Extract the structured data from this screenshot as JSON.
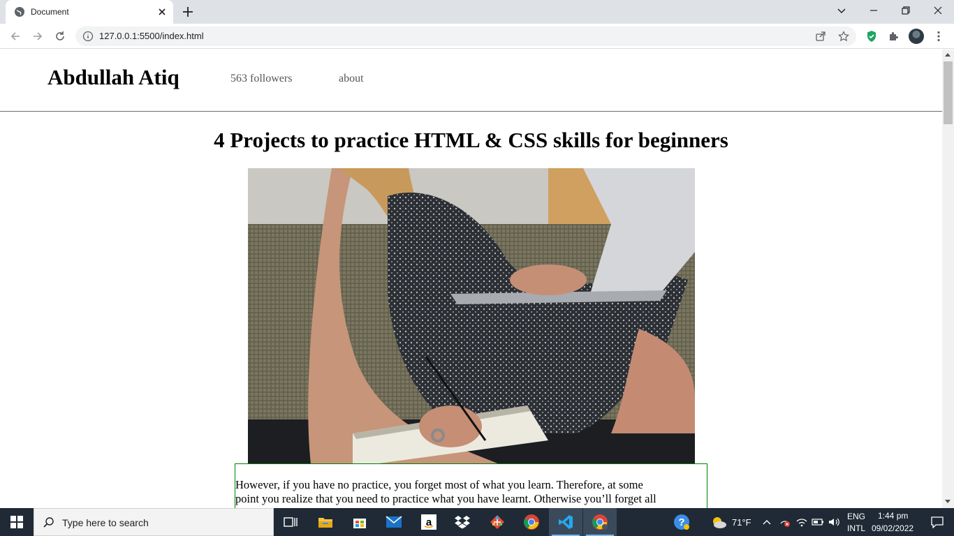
{
  "browser": {
    "tab": {
      "title": "Document"
    },
    "address": {
      "url": "127.0.0.1:5500/index.html"
    }
  },
  "site": {
    "brand": "Abdullah Atiq",
    "nav": {
      "followers": "563 followers",
      "about": "about"
    }
  },
  "article": {
    "title": "4 Projects to practice HTML & CSS skills for beginners",
    "paragraph_line1": "However, if you have no practice, you forget most of what you learn. Therefore, at some",
    "paragraph_line2": "point you realize that you need to practice what you have learnt. Otherwise you’ll forget all"
  },
  "taskbar": {
    "search_placeholder": "Type here to search",
    "weather": "71°F",
    "lang_line1": "ENG",
    "lang_line2": "INTL",
    "time": "1:44 pm",
    "date": "09/02/2022"
  },
  "icons": [
    "globe-icon",
    "close-icon",
    "plus-icon",
    "chevron-down-icon",
    "minimize-icon",
    "restore-icon",
    "window-close-icon",
    "back-icon",
    "forward-icon",
    "reload-icon",
    "info-icon",
    "share-icon",
    "star-icon",
    "shield-extension-icon",
    "puzzle-icon",
    "menu-icon",
    "windows-start-icon",
    "search-icon",
    "task-view-icon",
    "file-explorer-icon",
    "store-icon",
    "mail-icon",
    "amazon-icon",
    "dropbox-icon",
    "git-icon",
    "chrome-icon",
    "vscode-icon",
    "help-icon",
    "weather-icon",
    "chevron-up-icon",
    "battery-icon",
    "volume-icon",
    "notification-icon"
  ],
  "colors": {
    "tabstrip": "#dee1e6",
    "taskbar": "#1f2a36",
    "border_green": "#008000"
  }
}
